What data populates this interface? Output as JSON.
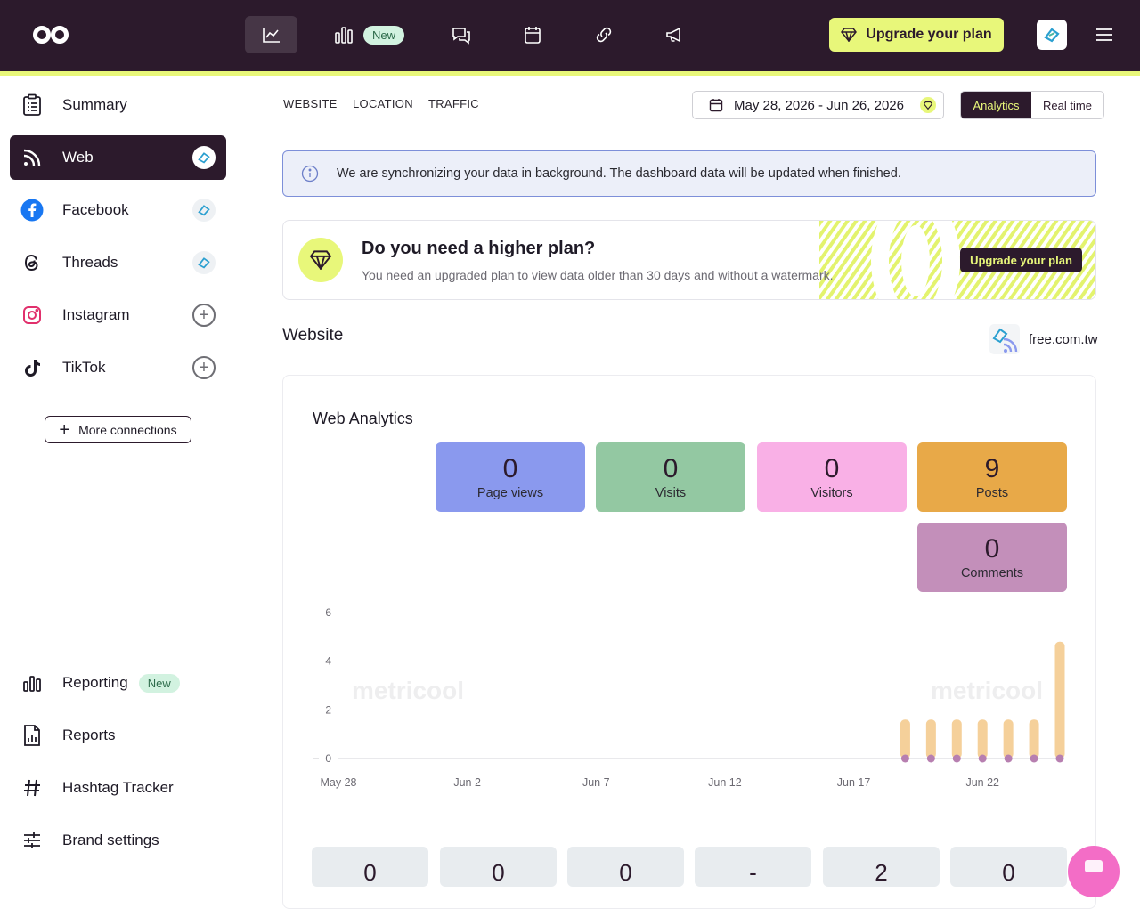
{
  "topbar": {
    "new_badge": "New",
    "upgrade_label": "Upgrade your plan",
    "icons": [
      "analytics-icon",
      "reporting-icon",
      "messages-icon",
      "calendar-icon",
      "link-icon",
      "megaphone-icon"
    ],
    "colors": {
      "background": "#2c1a2c",
      "accent": "#e8f77a"
    }
  },
  "sidebar": {
    "items": [
      {
        "label": "Summary"
      },
      {
        "label": "Web"
      },
      {
        "label": "Facebook"
      },
      {
        "label": "Threads"
      },
      {
        "label": "Instagram"
      },
      {
        "label": "TikTok"
      }
    ],
    "more_connections": "More connections",
    "bottom_items": [
      {
        "label": "Reporting",
        "badge": "New"
      },
      {
        "label": "Reports"
      },
      {
        "label": "Hashtag Tracker"
      },
      {
        "label": "Brand settings"
      }
    ]
  },
  "subnav": {
    "tabs": [
      "WEBSITE",
      "LOCATION",
      "TRAFFIC"
    ]
  },
  "date_range": "May 28, 2026 - Jun 26, 2026",
  "view_toggle": {
    "analytics": "Analytics",
    "realtime": "Real time",
    "selected": "Analytics"
  },
  "sync_notice": "We are synchronizing your data in background. The dashboard data will be updated when finished.",
  "plan_banner": {
    "title": "Do you need a higher plan?",
    "subtitle": "You need an upgraded plan to view data older than 30 days and without a watermark.",
    "button": "Upgrade your plan"
  },
  "website": {
    "section_title": "Website",
    "domain": "free.com.tw"
  },
  "analytics": {
    "title": "Web Analytics",
    "tiles": [
      {
        "value": "0",
        "label": "Page views",
        "color": "#8a99ee"
      },
      {
        "value": "0",
        "label": "Visits",
        "color": "#93c8a2"
      },
      {
        "value": "0",
        "label": "Visitors",
        "color": "#f9b0e6"
      },
      {
        "value": "9",
        "label": "Posts",
        "color": "#e8a948"
      },
      {
        "value": "0",
        "label": "Comments",
        "color": "#c38fba"
      }
    ],
    "watermark": "metricool",
    "bottom_tiles": [
      "0",
      "0",
      "0",
      "-",
      "2",
      "0"
    ]
  },
  "chart_data": {
    "type": "bar",
    "x_tick_labels": [
      "May 28",
      "Jun 2",
      "Jun 7",
      "Jun 12",
      "Jun 17",
      "Jun 22"
    ],
    "x_start": "May 28",
    "dates": [
      "May 28",
      "May 29",
      "May 30",
      "May 31",
      "Jun 1",
      "Jun 2",
      "Jun 3",
      "Jun 4",
      "Jun 5",
      "Jun 6",
      "Jun 7",
      "Jun 8",
      "Jun 9",
      "Jun 10",
      "Jun 11",
      "Jun 12",
      "Jun 13",
      "Jun 14",
      "Jun 15",
      "Jun 16",
      "Jun 17",
      "Jun 18",
      "Jun 19",
      "Jun 20",
      "Jun 21",
      "Jun 22",
      "Jun 23",
      "Jun 24",
      "Jun 25"
    ],
    "series": [
      {
        "values": [
          0,
          0,
          0,
          0,
          0,
          0,
          0,
          0,
          0,
          0,
          0,
          0,
          0,
          0,
          0,
          0,
          0,
          0,
          0,
          0,
          0,
          0,
          1.6,
          1.6,
          1.6,
          1.6,
          1.6,
          1.6,
          4.8
        ],
        "color": "#f5d09a"
      },
      {
        "values": [
          0,
          0,
          0,
          0,
          0,
          0,
          0,
          0,
          0,
          0,
          0,
          0,
          0,
          0,
          0,
          0,
          0,
          0,
          0,
          0,
          0,
          0,
          0,
          0,
          0,
          0,
          0,
          0,
          0
        ],
        "color": "#b77fb0"
      }
    ],
    "y_ticks": [
      0,
      2,
      4,
      6
    ],
    "ylim": [
      0,
      6
    ],
    "grid": false
  }
}
